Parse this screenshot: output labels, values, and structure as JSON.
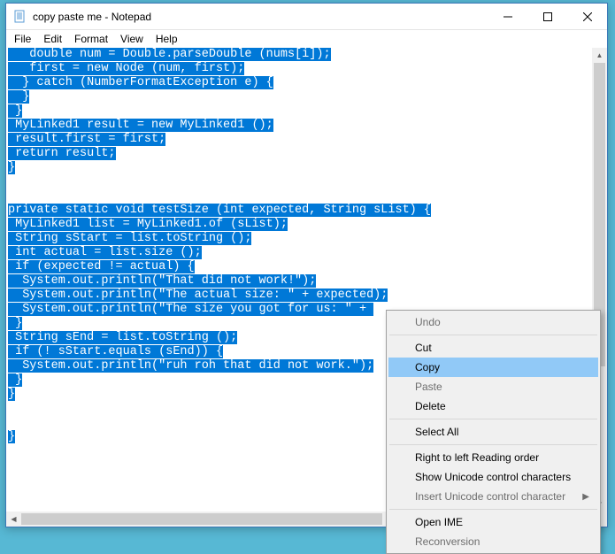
{
  "window": {
    "title": "copy paste me - Notepad"
  },
  "menu": {
    "file": "File",
    "edit": "Edit",
    "format": "Format",
    "view": "View",
    "help": "Help"
  },
  "code": {
    "lines": [
      "   double num = Double.parseDouble (nums[i]);",
      "   first = new Node (num, first);",
      "  } catch (NumberFormatException e) {",
      "  }",
      " }",
      " MyLinked1 result = new MyLinked1 ();",
      " result.first = first;",
      " return result;",
      "}",
      "",
      "",
      "private static void testSize (int expected, String sList) {",
      " MyLinked1 list = MyLinked1.of (sList);",
      " String sStart = list.toString ();",
      " int actual = list.size ();",
      " if (expected != actual) {",
      "  System.out.println(\"That did not work!\");",
      "  System.out.println(\"The actual size: \" + expected);",
      "  System.out.println(\"The size you got for us: \" + ",
      " }",
      " String sEnd = list.toString ();",
      " if (! sStart.equals (sEnd)) {",
      "  System.out.println(\"ruh roh that did not work.\");",
      " }",
      "}",
      "",
      "",
      "}"
    ]
  },
  "context_menu": {
    "undo": "Undo",
    "cut": "Cut",
    "copy": "Copy",
    "paste": "Paste",
    "delete": "Delete",
    "select_all": "Select All",
    "rtl": "Right to left Reading order",
    "show_unicode": "Show Unicode control characters",
    "insert_unicode": "Insert Unicode control character",
    "open_ime": "Open IME",
    "reconversion": "Reconversion"
  }
}
